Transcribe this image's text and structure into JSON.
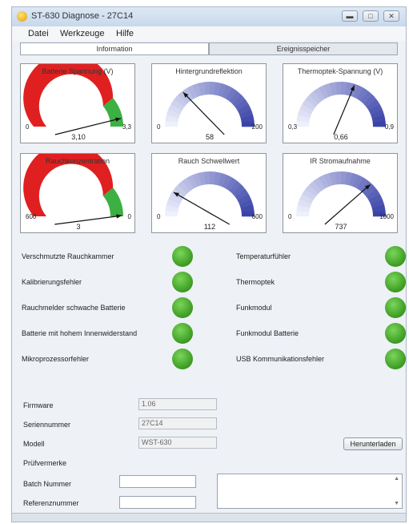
{
  "window": {
    "title": "ST-630 Diagnose - 27C14"
  },
  "menu": [
    "Datei",
    "Werkzeuge",
    "Hilfe"
  ],
  "tabs": [
    {
      "label": "Information",
      "active": true
    },
    {
      "label": "Ereignisspeicher",
      "active": false
    }
  ],
  "gauges": [
    {
      "title": "Batterie Spannung (V)",
      "min": "0",
      "max": "3,3",
      "value": "3,10",
      "fraction": 0.939,
      "style": "red-green"
    },
    {
      "title": "Hintergrundreflektion",
      "min": "0",
      "max": "200",
      "value": "58",
      "fraction": 0.29,
      "style": "blue"
    },
    {
      "title": "Thermoptek-Spannung (V)",
      "min": "0,3",
      "max": "0,9",
      "value": "0,66",
      "fraction": 0.6,
      "style": "blue"
    },
    {
      "title": "Rauchkonzentration",
      "min": "600",
      "max": "0",
      "value": "3",
      "fraction": 0.995,
      "style": "red-green"
    },
    {
      "title": "Rauch Schwellwert",
      "min": "0",
      "max": "600",
      "value": "112",
      "fraction": 0.187,
      "style": "blue"
    },
    {
      "title": "IR Stromaufnahme",
      "min": "0",
      "max": "1000",
      "value": "737",
      "fraction": 0.737,
      "style": "blue"
    }
  ],
  "status_left": [
    {
      "label": "Verschmutzte Rauchkammer",
      "state": "ok"
    },
    {
      "label": "Kalibrierungsfehler",
      "state": "ok"
    },
    {
      "label": "Rauchmelder schwache Batterie",
      "state": "ok"
    },
    {
      "label": "Batterie mit hohem Innenwiderstand",
      "state": "ok"
    },
    {
      "label": "Mikroprozessorfehler",
      "state": "ok"
    }
  ],
  "status_right": [
    {
      "label": "Temperaturfühler",
      "state": "ok"
    },
    {
      "label": "Thermoptek",
      "state": "ok"
    },
    {
      "label": "Funkmodul",
      "state": "ok"
    },
    {
      "label": "Funkmodul Batterie",
      "state": "ok"
    },
    {
      "label": "USB Kommunikationsfehler",
      "state": "ok"
    }
  ],
  "info": {
    "firmware_label": "Firmware",
    "firmware_value": "1.06",
    "serial_label": "Seriennummer",
    "serial_value": "27C14",
    "model_label": "Modell",
    "model_value": "WST-630",
    "download_button": "Herunterladen",
    "pruef_label": "Prüfvermerke",
    "batch_label": "Batch Nummer",
    "batch_value": "",
    "ref_label": "Referenznummer",
    "ref_value": ""
  },
  "colors": {
    "red": "#e02020",
    "green": "#3cb043",
    "blue": "#3a44a8",
    "led": "#4caf2e"
  }
}
